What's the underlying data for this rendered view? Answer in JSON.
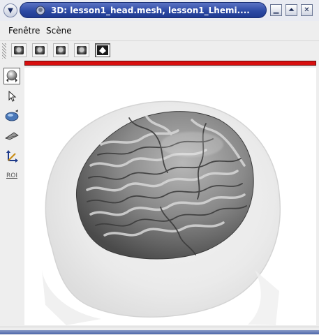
{
  "window": {
    "title": "3D: lesson1_head.mesh, lesson1_Lhemi....",
    "buttons": {
      "menu_icon": "chevron-down-icon",
      "minimize_label": "▁",
      "maximize_label": "⏶",
      "close_label": "✕"
    }
  },
  "menubar": {
    "items": [
      {
        "label": "Fenêtre"
      },
      {
        "label": "Scène"
      }
    ]
  },
  "toolbar": {
    "buttons": [
      {
        "icon": "brain-view-icon",
        "active": false
      },
      {
        "icon": "brain-view-icon",
        "active": false
      },
      {
        "icon": "brain-view-icon",
        "active": false
      },
      {
        "icon": "brain-view-icon",
        "active": false
      },
      {
        "icon": "3d-view-icon",
        "active": true
      }
    ]
  },
  "left_toolbar": {
    "items": [
      {
        "icon": "trackball-icon",
        "active": true
      },
      {
        "icon": "arrow-pointer-icon",
        "active": false
      },
      {
        "icon": "surface-paint-icon",
        "active": false
      },
      {
        "icon": "plane-icon",
        "active": false
      },
      {
        "icon": "transform-axes-icon",
        "active": false
      },
      {
        "label": "ROI",
        "icon": "roi-icon",
        "active": false
      }
    ]
  },
  "status": {
    "accent_color": "#d80f0f"
  },
  "viewer": {
    "content": "3d-brain-mesh",
    "mesh_color": "#7a7a7a",
    "head_color": "#e6e6e6"
  }
}
